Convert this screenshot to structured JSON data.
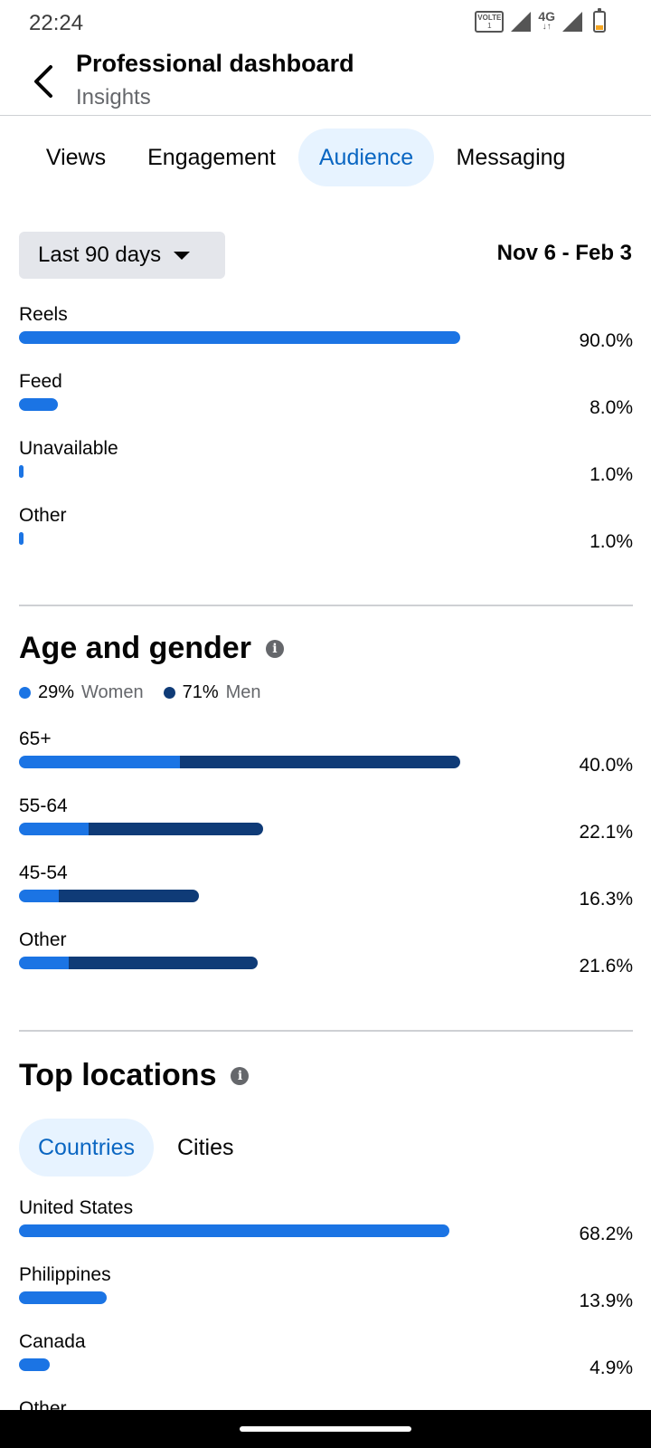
{
  "status": {
    "time": "22:24",
    "volte": "VOLTE",
    "volte_sub": "1",
    "network": "4G",
    "network_arrows": "↓↑"
  },
  "header": {
    "title": "Professional dashboard",
    "subtitle": "Insights"
  },
  "tabs": [
    {
      "label": "Views",
      "active": false
    },
    {
      "label": "Engagement",
      "active": false
    },
    {
      "label": "Audience",
      "active": true
    },
    {
      "label": "Messaging",
      "active": false
    }
  ],
  "filter": {
    "range_label": "Last 90 days",
    "date_range": "Nov 6 - Feb 3"
  },
  "sources": [
    {
      "label": "Reels",
      "value": "90.0%",
      "fraction": 0.9
    },
    {
      "label": "Feed",
      "value": "8.0%",
      "fraction": 0.08
    },
    {
      "label": "Unavailable",
      "value": "1.0%",
      "fraction": 0.01
    },
    {
      "label": "Other",
      "value": "1.0%",
      "fraction": 0.01
    }
  ],
  "age_gender": {
    "title": "Age and gender",
    "legend": [
      {
        "pct": "29%",
        "name": "Women",
        "color": "#1b74e4"
      },
      {
        "pct": "71%",
        "name": "Men",
        "color": "#0f3b77"
      }
    ],
    "rows": [
      {
        "label": "65+",
        "value": "40.0%",
        "total_fraction": 0.4,
        "women_fraction": 0.146,
        "men_fraction": 0.254
      },
      {
        "label": "55-64",
        "value": "22.1%",
        "total_fraction": 0.221,
        "women_fraction": 0.063,
        "men_fraction": 0.158
      },
      {
        "label": "45-54",
        "value": "16.3%",
        "total_fraction": 0.163,
        "women_fraction": 0.036,
        "men_fraction": 0.127
      },
      {
        "label": "Other",
        "value": "21.6%",
        "total_fraction": 0.216,
        "women_fraction": 0.045,
        "men_fraction": 0.171
      }
    ]
  },
  "top_locations": {
    "title": "Top locations",
    "chips": [
      {
        "label": "Countries",
        "active": true
      },
      {
        "label": "Cities",
        "active": false
      }
    ],
    "rows": [
      {
        "label": "United States",
        "value": "68.2%",
        "fraction": 0.682
      },
      {
        "label": "Philippines",
        "value": "13.9%",
        "fraction": 0.139
      },
      {
        "label": "Canada",
        "value": "4.9%",
        "fraction": 0.049
      },
      {
        "label": "Other",
        "value": "",
        "fraction": 0
      }
    ]
  },
  "colors": {
    "accent": "#1b74e4",
    "dark_series": "#0f3b77",
    "active_tab_bg": "#e7f3ff",
    "active_tab_text": "#0a66c2"
  }
}
